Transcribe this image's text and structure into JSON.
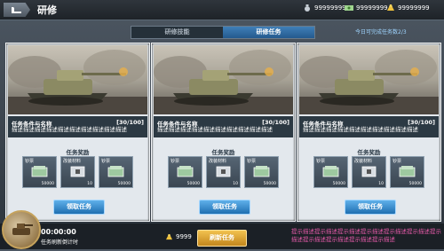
{
  "header": {
    "title": "研修"
  },
  "currencies": [
    {
      "icon": "medal-icon",
      "value": "99999999"
    },
    {
      "icon": "cash-icon",
      "value": "99999999"
    },
    {
      "icon": "gold-bars-icon",
      "value": "99999999"
    }
  ],
  "tabs": [
    {
      "label": "研修技能",
      "active": false
    },
    {
      "label": "研修任务",
      "active": true
    }
  ],
  "daily": "今日可完成任务数2/3",
  "cards": [
    {
      "name": "任务条件与名称",
      "progress": "[30/100]",
      "desc": "描述描述描述描述描述描述描述描述描述描述",
      "rewards_label": "任务奖励",
      "rewards": [
        {
          "name": "钞票",
          "count": "50000"
        },
        {
          "name": "改装材料",
          "count": "10"
        },
        {
          "name": "钞票",
          "count": "50000"
        }
      ],
      "claim": "领取任务"
    },
    {
      "name": "任务条件与名称",
      "progress": "[30/100]",
      "desc": "描述描述描述描述描述描述描述描述描述描述",
      "rewards_label": "任务奖励",
      "rewards": [
        {
          "name": "钞票",
          "count": "50000"
        },
        {
          "name": "改装材料",
          "count": "10"
        },
        {
          "name": "钞票",
          "count": "50000"
        }
      ],
      "claim": "领取任务"
    },
    {
      "name": "任务条件与名称",
      "progress": "[30/100]",
      "desc": "描述描述描述描述描述描述描述描述描述描述",
      "rewards_label": "任务奖励",
      "rewards": [
        {
          "name": "钞票",
          "count": "50000"
        },
        {
          "name": "改装材料",
          "count": "10"
        },
        {
          "name": "钞票",
          "count": "50000"
        }
      ],
      "claim": "领取任务"
    }
  ],
  "footer": {
    "timer": "00:00:00",
    "timer_label": "任务刷新倒计时",
    "gold_amount": "9999",
    "refresh_label": "刷新任务",
    "tip": "提示描述提示描述提示描述提示描述提示描述提示描述提示描述提示描述提示描述提示描述提示描述"
  }
}
